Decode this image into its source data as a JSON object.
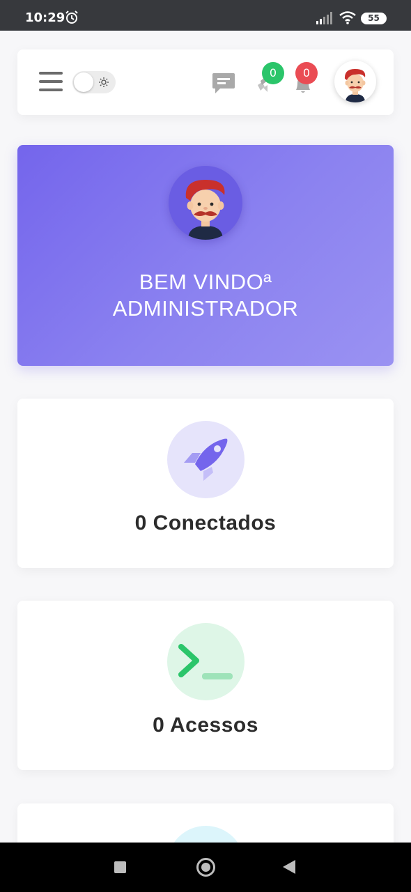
{
  "status_bar": {
    "time": "10:29",
    "battery": "55"
  },
  "header": {
    "messages_badge": "0",
    "notifications_badge": "0"
  },
  "welcome": {
    "line1": "BEM VINDOª",
    "line2": "ADMINISTRADOR"
  },
  "stats": [
    {
      "label": "0 Conectados",
      "icon": "rocket-icon",
      "color": "#7465ec"
    },
    {
      "label": "0 Acessos",
      "icon": "terminal-icon",
      "color": "#2bc56a"
    },
    {
      "label": "",
      "icon": "",
      "color": "#5bd3ee"
    }
  ],
  "colors": {
    "accent": "#7465ec",
    "success": "#2bc56a",
    "danger": "#ea4c54"
  }
}
